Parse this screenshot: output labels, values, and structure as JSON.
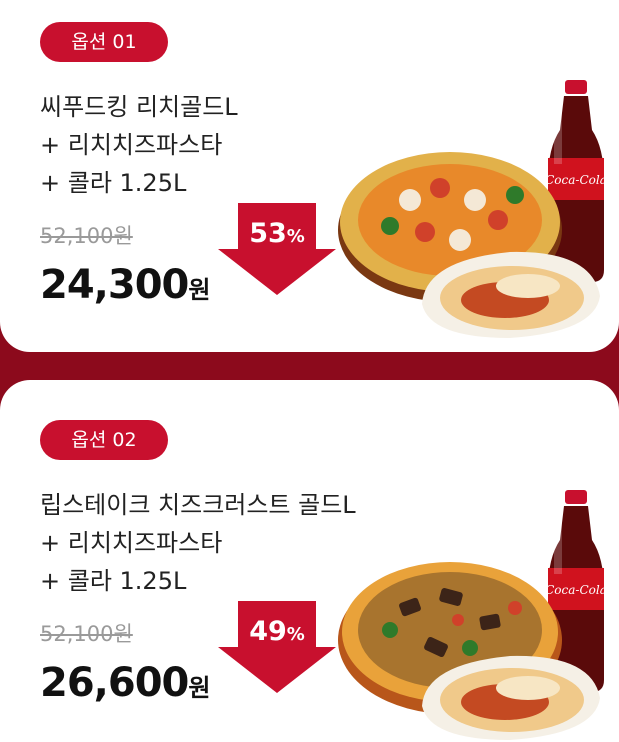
{
  "options": [
    {
      "badge": "옵션 01",
      "title_lines": [
        "씨푸드킹 리치골드L",
        "+ 리치치즈파스타",
        "+ 콜라 1.25L"
      ],
      "original_price": "52,100원",
      "discount_value": "53",
      "discount_unit": "%",
      "price_value": "24,300",
      "price_unit": "원"
    },
    {
      "badge": "옵션 02",
      "title_lines": [
        "립스테이크 치즈크러스트 골드L",
        "+ 리치치즈파스타",
        "+ 콜라 1.25L"
      ],
      "original_price": "52,100원",
      "discount_value": "49",
      "discount_unit": "%",
      "price_value": "26,600",
      "price_unit": "원"
    }
  ],
  "colors": {
    "accent_red": "#c8102e",
    "background_maroon": "#8c0a1c"
  },
  "icons": {
    "discount": "down-arrow-icon",
    "product": "pizza-pasta-cola-image"
  }
}
